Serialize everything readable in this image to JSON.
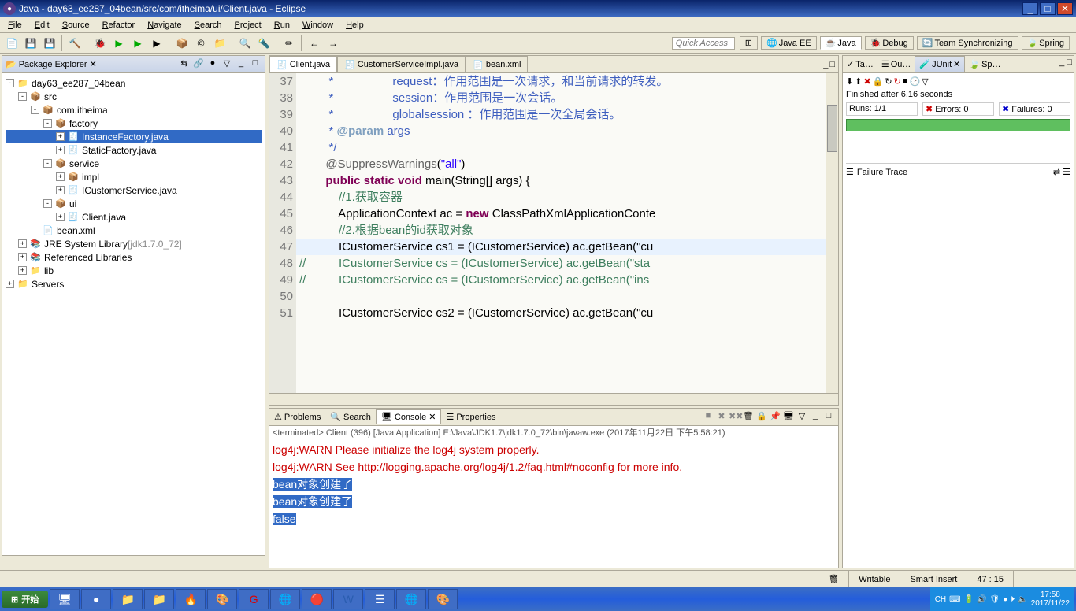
{
  "window": {
    "title": "Java - day63_ee287_04bean/src/com/itheima/ui/Client.java - Eclipse"
  },
  "menu": [
    "File",
    "Edit",
    "Source",
    "Refactor",
    "Navigate",
    "Search",
    "Project",
    "Run",
    "Window",
    "Help"
  ],
  "quickAccess": "Quick Access",
  "perspectives": [
    "Java EE",
    "Java",
    "Debug",
    "Team Synchronizing",
    "Spring"
  ],
  "packageExplorer": {
    "title": "Package Explorer",
    "tree": [
      {
        "d": 0,
        "exp": "-",
        "icon": "📁",
        "label": "day63_ee287_04bean"
      },
      {
        "d": 1,
        "exp": "-",
        "icon": "📦",
        "label": "src"
      },
      {
        "d": 2,
        "exp": "-",
        "icon": "📦",
        "label": "com.itheima"
      },
      {
        "d": 3,
        "exp": "-",
        "icon": "📦",
        "label": "factory"
      },
      {
        "d": 4,
        "exp": "+",
        "icon": "🧾",
        "label": "InstanceFactory.java",
        "selected": true
      },
      {
        "d": 4,
        "exp": "+",
        "icon": "🧾",
        "label": "StaticFactory.java"
      },
      {
        "d": 3,
        "exp": "-",
        "icon": "📦",
        "label": "service"
      },
      {
        "d": 4,
        "exp": "+",
        "icon": "📦",
        "label": "impl"
      },
      {
        "d": 4,
        "exp": "+",
        "icon": "🧾",
        "label": "ICustomerService.java"
      },
      {
        "d": 3,
        "exp": "-",
        "icon": "📦",
        "label": "ui"
      },
      {
        "d": 4,
        "exp": "+",
        "icon": "🧾",
        "label": "Client.java"
      },
      {
        "d": 2,
        "exp": "",
        "icon": "📄",
        "label": "bean.xml"
      },
      {
        "d": 1,
        "exp": "+",
        "icon": "📚",
        "label": "JRE System Library",
        "gray": "[jdk1.7.0_72]"
      },
      {
        "d": 1,
        "exp": "+",
        "icon": "📚",
        "label": "Referenced Libraries"
      },
      {
        "d": 1,
        "exp": "+",
        "icon": "📁",
        "label": "lib"
      },
      {
        "d": 0,
        "exp": "+",
        "icon": "📁",
        "label": "Servers"
      }
    ]
  },
  "editorTabs": [
    {
      "label": "Client.java",
      "active": true
    },
    {
      "label": "CustomerServiceImpl.java"
    },
    {
      "label": "bean.xml"
    }
  ],
  "code": {
    "startLine": 37,
    "highlightLine": 47,
    "lines": [
      {
        "t": "doc",
        "text": "         *                  request：作用范围是一次请求，和当前请求的转发。"
      },
      {
        "t": "doc",
        "text": "         *                  session：作用范围是一次会话。"
      },
      {
        "t": "doc",
        "text": "         *                  globalsession ：作用范围是一次全局会话。"
      },
      {
        "t": "doctag",
        "text": "         * @param args"
      },
      {
        "t": "doc",
        "text": "         */"
      },
      {
        "t": "ann",
        "text": "        @SuppressWarnings(\"all\")"
      },
      {
        "t": "main",
        "text": "        public static void main(String[] args) {"
      },
      {
        "t": "comment",
        "text": "            //1.获取容器"
      },
      {
        "t": "new",
        "text": "            ApplicationContext ac = new ClassPathXmlApplicationConte"
      },
      {
        "t": "comment",
        "text": "            //2.根据bean的id获取对象"
      },
      {
        "t": "code",
        "text": "            ICustomerService cs1 = (ICustomerService) ac.getBean(\"cu"
      },
      {
        "t": "comment",
        "text": "//          ICustomerService cs = (ICustomerService) ac.getBean(\"sta"
      },
      {
        "t": "comment",
        "text": "//          ICustomerService cs = (ICustomerService) ac.getBean(\"ins"
      },
      {
        "t": "code",
        "text": ""
      },
      {
        "t": "code",
        "text": "            ICustomerService cs2 = (ICustomerService) ac.getBean(\"cu"
      }
    ]
  },
  "bottomTabs": [
    "Problems",
    "Search",
    "Console",
    "Properties"
  ],
  "console": {
    "info": "<terminated> Client (396) [Java Application] E:\\Java\\JDK1.7\\jdk1.7.0_72\\bin\\javaw.exe (2017年11月22日 下午5:58:21)",
    "lines": [
      {
        "cls": "warn",
        "text": "log4j:WARN Please initialize the log4j system properly."
      },
      {
        "cls": "warn",
        "text": "log4j:WARN See http://logging.apache.org/log4j/1.2/faq.html#noconfig for more info."
      },
      {
        "cls": "selected",
        "text": "bean对象创建了"
      },
      {
        "cls": "selected",
        "text": "bean对象创建了"
      },
      {
        "cls": "selected",
        "text": "false"
      }
    ]
  },
  "rightTabs": [
    "Ta…",
    "Ou…",
    "JUnit",
    "Sp…"
  ],
  "junit": {
    "finished": "Finished after 6.16 seconds",
    "runs": "Runs:",
    "runsVal": "1/1",
    "errors": "Errors:",
    "errorsVal": "0",
    "failures": "Failures:",
    "failuresVal": "0",
    "failureTrace": "Failure Trace"
  },
  "statusbar": {
    "writable": "Writable",
    "insert": "Smart Insert",
    "pos": "47 : 15"
  },
  "taskbar": {
    "start": "开始",
    "ime": "CH",
    "time": "17:58",
    "date": "2017/11/22"
  }
}
